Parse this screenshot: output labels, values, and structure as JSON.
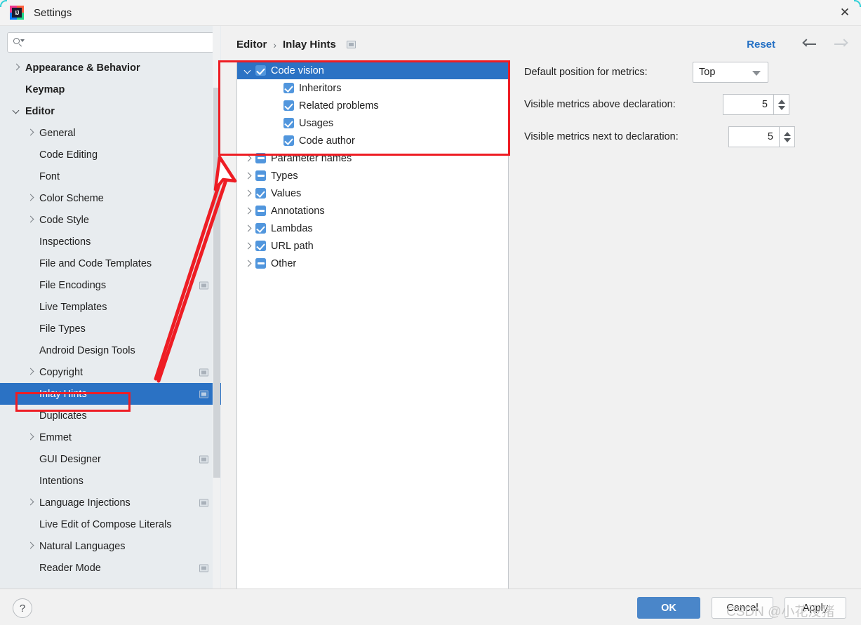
{
  "window": {
    "title": "Settings",
    "app_icon": "intellij-idea-icon",
    "close_label": "✕"
  },
  "sidebar": {
    "search": {
      "placeholder": "",
      "value": "",
      "icon": "search-icon"
    },
    "items": [
      {
        "label": "Appearance & Behavior",
        "arrow": "right",
        "bold": true,
        "indent": 0,
        "badge": false,
        "selected": false
      },
      {
        "label": "Keymap",
        "arrow": "none",
        "bold": true,
        "indent": 0,
        "badge": false,
        "selected": false
      },
      {
        "label": "Editor",
        "arrow": "down",
        "bold": true,
        "indent": 0,
        "badge": false,
        "selected": false
      },
      {
        "label": "General",
        "arrow": "right",
        "bold": false,
        "indent": 1,
        "badge": false,
        "selected": false
      },
      {
        "label": "Code Editing",
        "arrow": "none",
        "bold": false,
        "indent": 1,
        "badge": false,
        "selected": false
      },
      {
        "label": "Font",
        "arrow": "none",
        "bold": false,
        "indent": 1,
        "badge": false,
        "selected": false
      },
      {
        "label": "Color Scheme",
        "arrow": "right",
        "bold": false,
        "indent": 1,
        "badge": false,
        "selected": false
      },
      {
        "label": "Code Style",
        "arrow": "right",
        "bold": false,
        "indent": 1,
        "badge": false,
        "selected": false
      },
      {
        "label": "Inspections",
        "arrow": "none",
        "bold": false,
        "indent": 1,
        "badge": false,
        "selected": false
      },
      {
        "label": "File and Code Templates",
        "arrow": "none",
        "bold": false,
        "indent": 1,
        "badge": false,
        "selected": false
      },
      {
        "label": "File Encodings",
        "arrow": "none",
        "bold": false,
        "indent": 1,
        "badge": true,
        "selected": false
      },
      {
        "label": "Live Templates",
        "arrow": "none",
        "bold": false,
        "indent": 1,
        "badge": false,
        "selected": false
      },
      {
        "label": "File Types",
        "arrow": "none",
        "bold": false,
        "indent": 1,
        "badge": false,
        "selected": false
      },
      {
        "label": "Android Design Tools",
        "arrow": "none",
        "bold": false,
        "indent": 1,
        "badge": false,
        "selected": false
      },
      {
        "label": "Copyright",
        "arrow": "right",
        "bold": false,
        "indent": 1,
        "badge": true,
        "selected": false
      },
      {
        "label": "Inlay Hints",
        "arrow": "none",
        "bold": false,
        "indent": 1,
        "badge": true,
        "selected": true
      },
      {
        "label": "Duplicates",
        "arrow": "none",
        "bold": false,
        "indent": 1,
        "badge": false,
        "selected": false
      },
      {
        "label": "Emmet",
        "arrow": "right",
        "bold": false,
        "indent": 1,
        "badge": false,
        "selected": false
      },
      {
        "label": "GUI Designer",
        "arrow": "none",
        "bold": false,
        "indent": 1,
        "badge": true,
        "selected": false
      },
      {
        "label": "Intentions",
        "arrow": "none",
        "bold": false,
        "indent": 1,
        "badge": false,
        "selected": false
      },
      {
        "label": "Language Injections",
        "arrow": "right",
        "bold": false,
        "indent": 1,
        "badge": true,
        "selected": false
      },
      {
        "label": "Live Edit of Compose Literals",
        "arrow": "none",
        "bold": false,
        "indent": 1,
        "badge": false,
        "selected": false
      },
      {
        "label": "Natural Languages",
        "arrow": "right",
        "bold": false,
        "indent": 1,
        "badge": false,
        "selected": false
      },
      {
        "label": "Reader Mode",
        "arrow": "none",
        "bold": false,
        "indent": 1,
        "badge": true,
        "selected": false
      }
    ]
  },
  "main": {
    "breadcrumb": {
      "root": "Editor",
      "separator": "›",
      "leaf": "Inlay Hints",
      "badge": "module-badge-icon"
    },
    "reset_label": "Reset",
    "nav": {
      "back_icon": "arrow-left-icon",
      "forward_icon": "arrow-right-icon"
    },
    "hint_tree": [
      {
        "label": "Code vision",
        "expander": "down",
        "check": "checked",
        "indent": 1,
        "selected": true
      },
      {
        "label": "Inheritors",
        "expander": "none",
        "check": "checked",
        "indent": 2,
        "selected": false
      },
      {
        "label": "Related problems",
        "expander": "none",
        "check": "checked",
        "indent": 2,
        "selected": false
      },
      {
        "label": "Usages",
        "expander": "none",
        "check": "checked",
        "indent": 2,
        "selected": false
      },
      {
        "label": "Code author",
        "expander": "none",
        "check": "checked",
        "indent": 2,
        "selected": false
      },
      {
        "label": "Parameter names",
        "expander": "right",
        "check": "partial",
        "indent": 1,
        "selected": false
      },
      {
        "label": "Types",
        "expander": "right",
        "check": "partial",
        "indent": 1,
        "selected": false
      },
      {
        "label": "Values",
        "expander": "right",
        "check": "checked",
        "indent": 1,
        "selected": false
      },
      {
        "label": "Annotations",
        "expander": "right",
        "check": "partial",
        "indent": 1,
        "selected": false
      },
      {
        "label": "Lambdas",
        "expander": "right",
        "check": "checked",
        "indent": 1,
        "selected": false
      },
      {
        "label": "URL path",
        "expander": "right",
        "check": "checked",
        "indent": 1,
        "selected": false
      },
      {
        "label": "Other",
        "expander": "right",
        "check": "partial",
        "indent": 1,
        "selected": false
      }
    ],
    "settings": {
      "position_label": "Default position for metrics:",
      "position_value": "Top",
      "above_label": "Visible metrics above declaration:",
      "above_value": "5",
      "next_label": "Visible metrics next to declaration:",
      "next_value": "5"
    }
  },
  "footer": {
    "help_label": "?",
    "ok_label": "OK",
    "cancel_label": "Cancel",
    "apply_label": "Apply"
  },
  "watermark": "CSDN @小花没猪",
  "colors": {
    "accent_blue": "#2b72c4",
    "checkbox_blue": "#5196dd",
    "link_blue": "#2470c4",
    "annotation_red": "#ee1d24",
    "sidebar_bg": "#e8ecef",
    "panel_bg": "#f1f1f1"
  }
}
